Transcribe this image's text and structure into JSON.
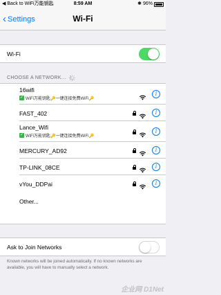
{
  "status_bar": {
    "back_app": "◀ Back to WiFi万能钥匙",
    "time": "8:59 AM",
    "battery_text": "96%",
    "battery_level": 0.96
  },
  "nav": {
    "back_label": "Settings",
    "title": "Wi-Fi"
  },
  "wifi_toggle": {
    "label": "Wi-Fi",
    "on": true
  },
  "networks_section": {
    "header": "CHOOSE A NETWORK..."
  },
  "networks": [
    {
      "name": "16wifi",
      "subtitle": "WiFi万能钥匙🔑一键连接免费WiFi🔑",
      "locked": false
    },
    {
      "name": "FAST_402",
      "subtitle": "",
      "locked": true
    },
    {
      "name": "Lance_Wifi",
      "subtitle": "WiFi万能钥匙🔑一键连接免费WiFi🔑",
      "locked": true
    },
    {
      "name": "MERCURY_AD92",
      "subtitle": "",
      "locked": true
    },
    {
      "name": "TP-LINK_08CE",
      "subtitle": "",
      "locked": true
    },
    {
      "name": "vYou_DDPai",
      "subtitle": "",
      "locked": true
    }
  ],
  "other_label": "Other...",
  "ask_to_join": {
    "label": "Ask to Join Networks",
    "on": false
  },
  "footer_note": "Known networks will be joined automatically. If no known networks are available, you will have to manually select a network.",
  "watermark": "企业网 D1Net",
  "colors": {
    "accent": "#007aff",
    "toggle_on": "#4cd964",
    "background": "#efeff4"
  },
  "icons": {
    "wifi": "wifi-signal-icon",
    "lock": "lock-icon",
    "info": "info-icon",
    "check": "check-badge-icon",
    "key": "key-icon"
  }
}
